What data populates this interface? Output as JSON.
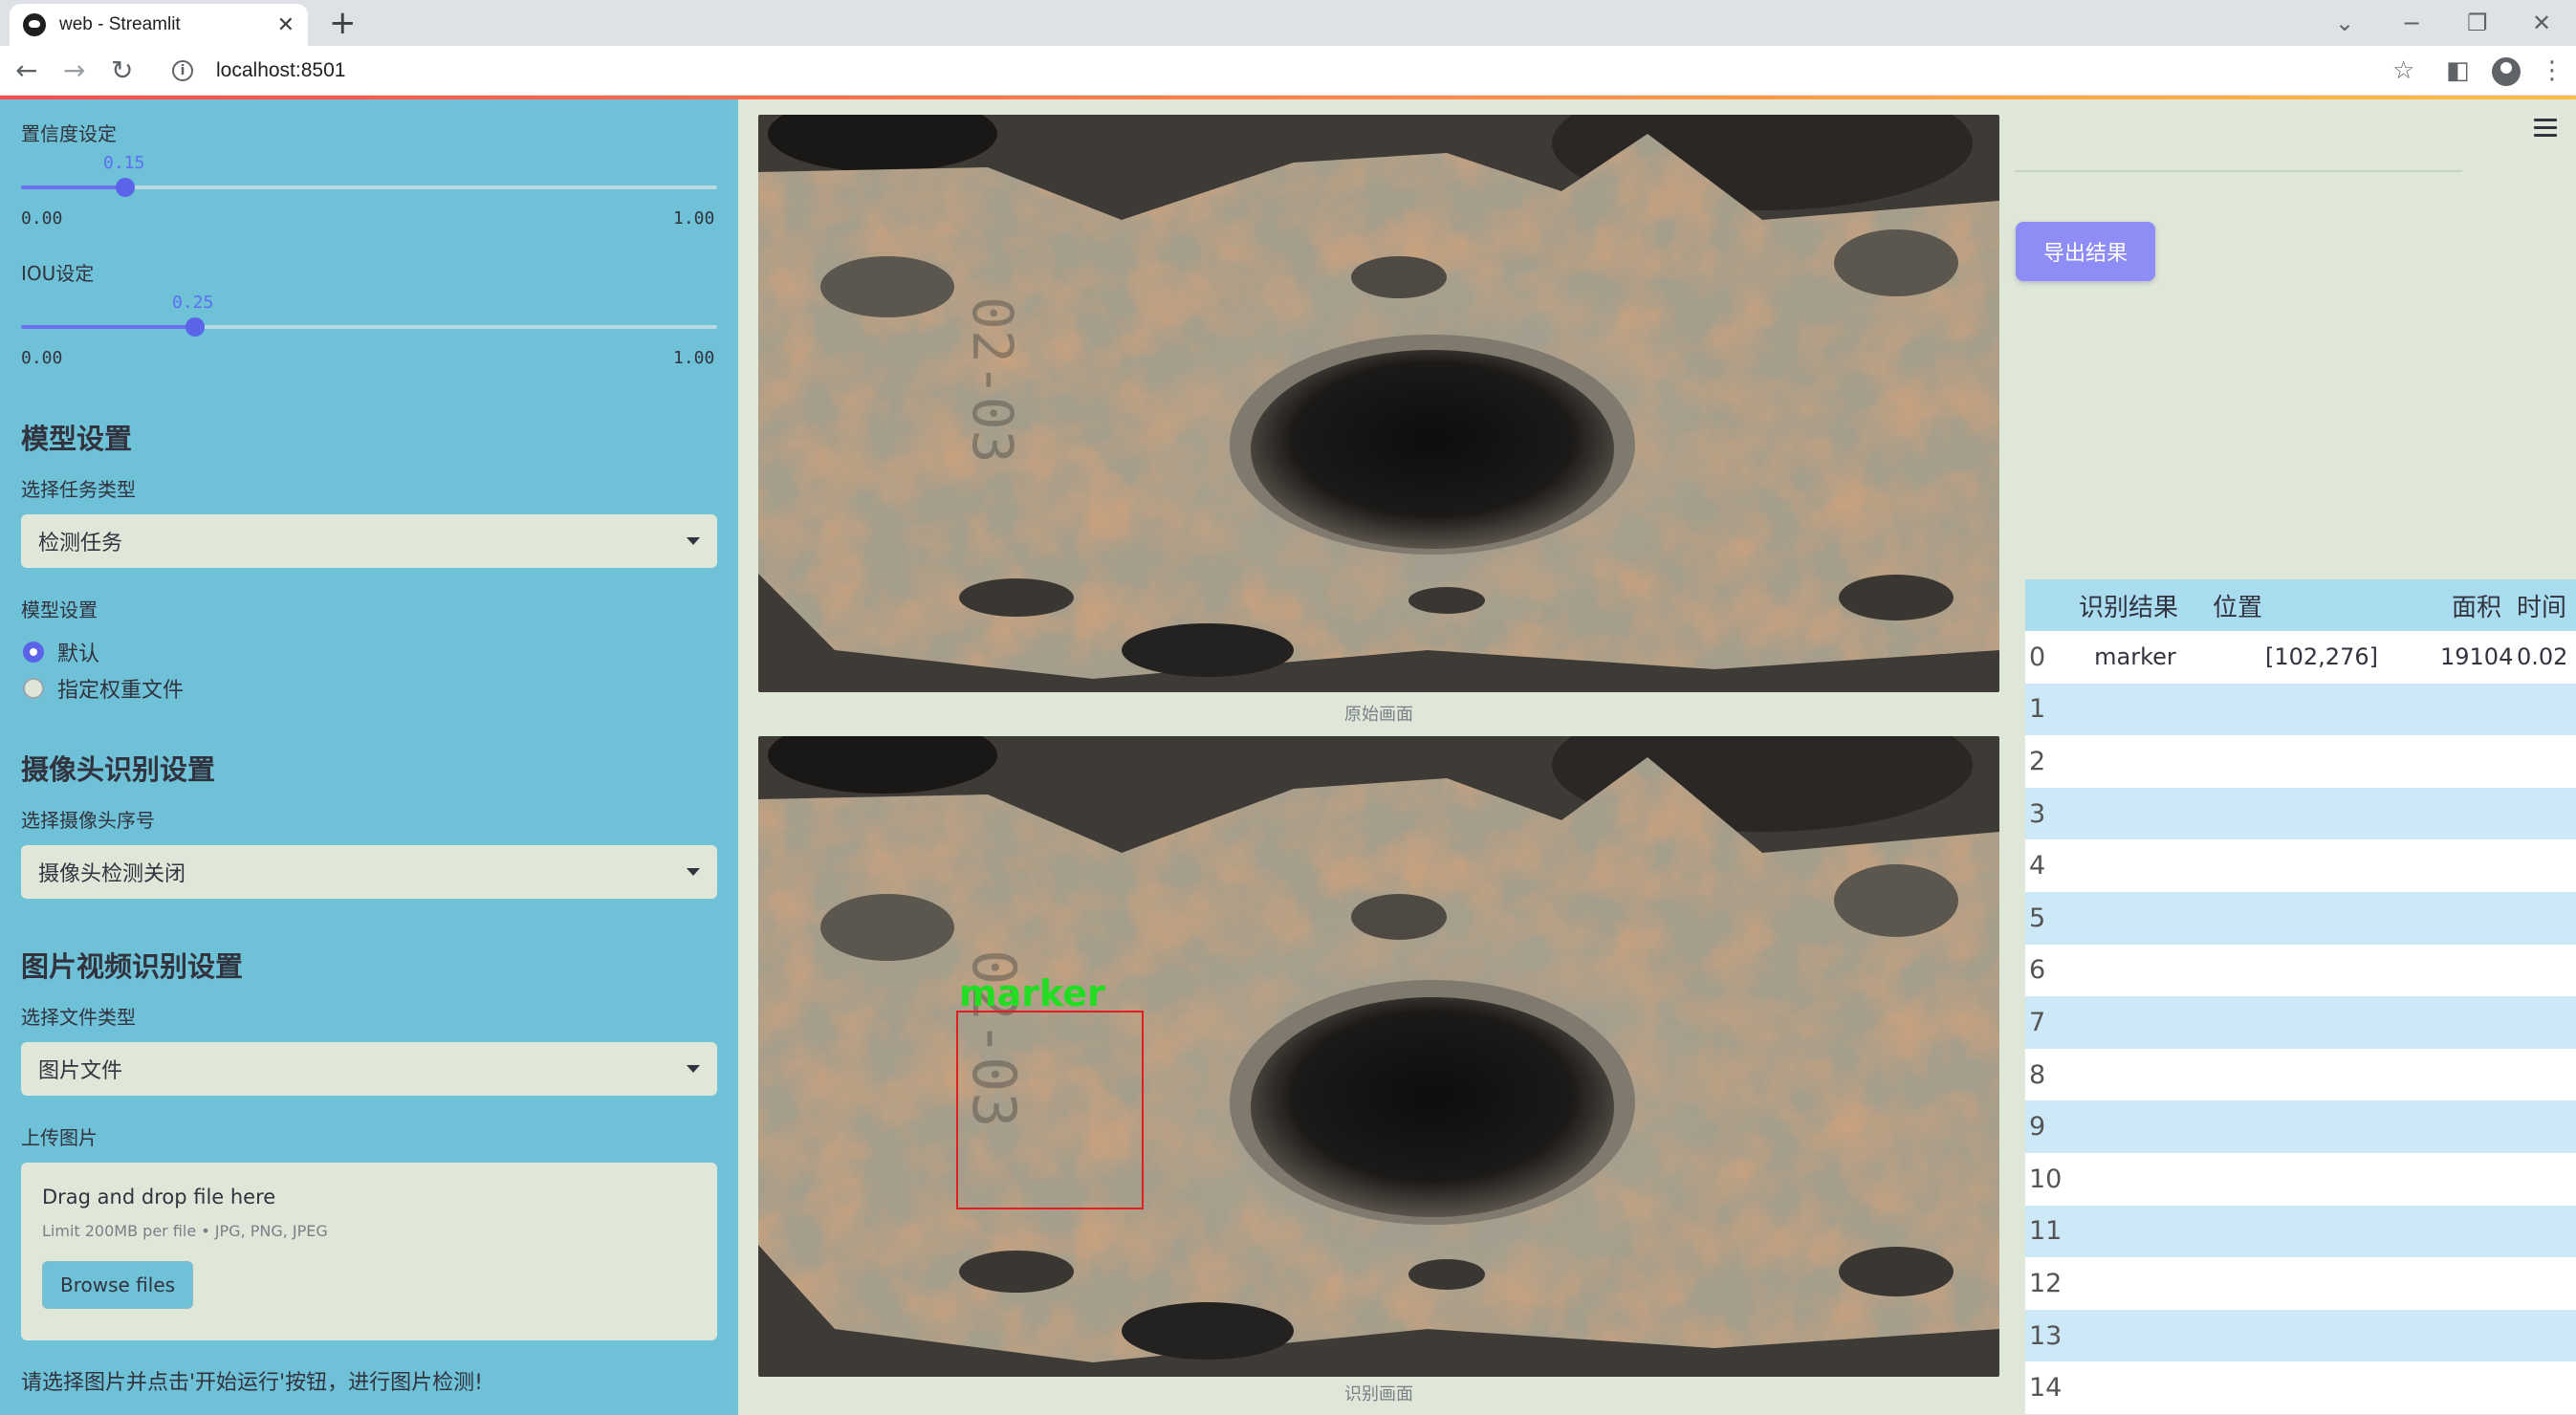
{
  "browser": {
    "tab_title": "web - Streamlit",
    "url": "localhost:8501"
  },
  "sidebar": {
    "confidence": {
      "label": "置信度设定",
      "value": "0.15",
      "value_fraction": 0.15,
      "min": "0.00",
      "max": "1.00"
    },
    "iou": {
      "label": "IOU设定",
      "value": "0.25",
      "value_fraction": 0.25,
      "min": "0.00",
      "max": "1.00"
    },
    "model_heading": "模型设置",
    "task_label": "选择任务类型",
    "task_value": "检测任务",
    "model_label": "模型设置",
    "model_options": [
      "默认",
      "指定权重文件"
    ],
    "model_selected": "默认",
    "camera_heading": "摄像头识别设置",
    "camera_label": "选择摄像头序号",
    "camera_value": "摄像头检测关闭",
    "media_heading": "图片视频识别设置",
    "filetype_label": "选择文件类型",
    "filetype_value": "图片文件",
    "upload_label": "上传图片",
    "upload_title": "Drag and drop file here",
    "upload_limit": "Limit 200MB per file • JPG, PNG, JPEG",
    "browse_label": "Browse files",
    "footer_text": "请选择图片并点击'开始运行'按钮，进行图片检测!"
  },
  "main": {
    "original_caption": "原始画面",
    "detected_caption": "识别画面",
    "detection_label": "marker",
    "export_label": "导出结果"
  },
  "table": {
    "headers": [
      "",
      "识别结果",
      "位置",
      "面积",
      "时间"
    ],
    "rows": [
      {
        "idx": "0",
        "result": "marker",
        "position": "[102,276]",
        "area": "19104",
        "time": "0.02"
      },
      {
        "idx": "1",
        "result": "",
        "position": "",
        "area": "",
        "time": ""
      },
      {
        "idx": "2",
        "result": "",
        "position": "",
        "area": "",
        "time": ""
      },
      {
        "idx": "3",
        "result": "",
        "position": "",
        "area": "",
        "time": ""
      },
      {
        "idx": "4",
        "result": "",
        "position": "",
        "area": "",
        "time": ""
      },
      {
        "idx": "5",
        "result": "",
        "position": "",
        "area": "",
        "time": ""
      },
      {
        "idx": "6",
        "result": "",
        "position": "",
        "area": "",
        "time": ""
      },
      {
        "idx": "7",
        "result": "",
        "position": "",
        "area": "",
        "time": ""
      },
      {
        "idx": "8",
        "result": "",
        "position": "",
        "area": "",
        "time": ""
      },
      {
        "idx": "9",
        "result": "",
        "position": "",
        "area": "",
        "time": ""
      },
      {
        "idx": "10",
        "result": "",
        "position": "",
        "area": "",
        "time": ""
      },
      {
        "idx": "11",
        "result": "",
        "position": "",
        "area": "",
        "time": ""
      },
      {
        "idx": "12",
        "result": "",
        "position": "",
        "area": "",
        "time": ""
      },
      {
        "idx": "13",
        "result": "",
        "position": "",
        "area": "",
        "time": ""
      },
      {
        "idx": "14",
        "result": "",
        "position": "",
        "area": "",
        "time": ""
      }
    ]
  },
  "colors": {
    "sidebar_bg": "#6ec1d6",
    "main_bg": "#dfe8d8",
    "accent": "#5b63e8",
    "export_button": "#8e8cf5",
    "detection_box": "#e02020",
    "detection_text": "#22dd22"
  }
}
